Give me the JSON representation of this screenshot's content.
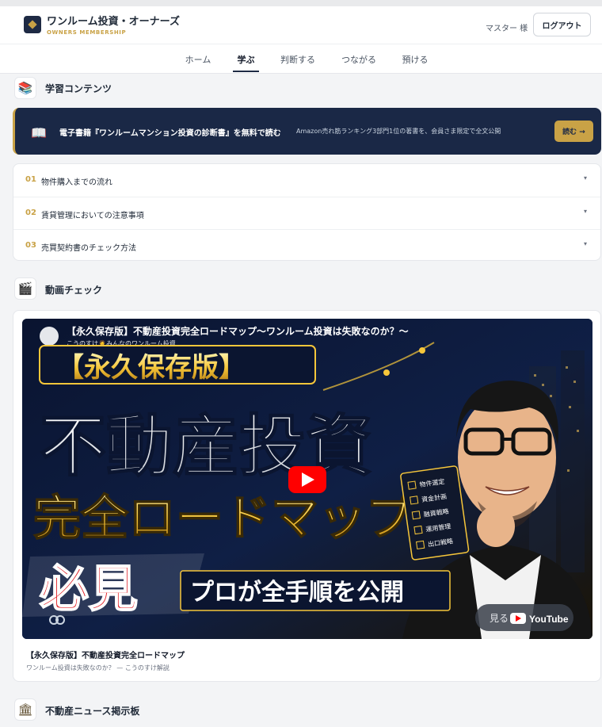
{
  "header": {
    "brand_title": "ワンルーム投資・オーナーズ",
    "brand_subtitle": "OWNERS MEMBERSHIP",
    "user_name": "マスター 様",
    "logout_label": "ログアウト"
  },
  "nav": {
    "tabs": [
      {
        "label": "ホーム"
      },
      {
        "label": "学ぶ"
      },
      {
        "label": "判断する"
      },
      {
        "label": "つながる"
      },
      {
        "label": "預ける"
      }
    ],
    "active": "学ぶ"
  },
  "learning": {
    "title": "学習コンテンツ",
    "banner": {
      "title": "電子書籍『ワンルームマンション投資の診断書』を無料で読む",
      "description": "Amazon売れ筋ランキング3部門1位の著書を、会員さま限定で全文公開",
      "button_label": "読む →"
    },
    "items": [
      {
        "num": "01",
        "label": "物件購入までの流れ"
      },
      {
        "num": "02",
        "label": "賃貸管理においての注意事項"
      },
      {
        "num": "03",
        "label": "売買契約書のチェック方法"
      }
    ]
  },
  "video_section": {
    "title": "動画チェック",
    "thumbnail": {
      "top_title": "【永久保存版】不動産投資完全ロードマップ〜ワンルーム投資は失敗なのか？〜",
      "channel": "こうのすけ🧑‍💼みんなのワンルーム投資",
      "badge": "【永久保存版】",
      "headline": "不動産投資",
      "headline2": "完全ロードマップ",
      "must_see": "必見",
      "pro": "プロが全手順を公開",
      "checklist": [
        "物件選定",
        "資金計画",
        "融資戦略",
        "運用管理",
        "出口戦略"
      ],
      "watch_on": "見る",
      "youtube": "YouTube"
    },
    "video_title": "【永久保存版】不動産投資完全ロードマップ",
    "video_subtitle": "ワンルーム投資は失敗なのか？ — こうのすけ解説"
  },
  "news": {
    "title": "不動産ニュース掲示板"
  },
  "colors": {
    "navy": "#1a2846",
    "gold": "#c9a246",
    "youtube_red": "#ff0000"
  }
}
